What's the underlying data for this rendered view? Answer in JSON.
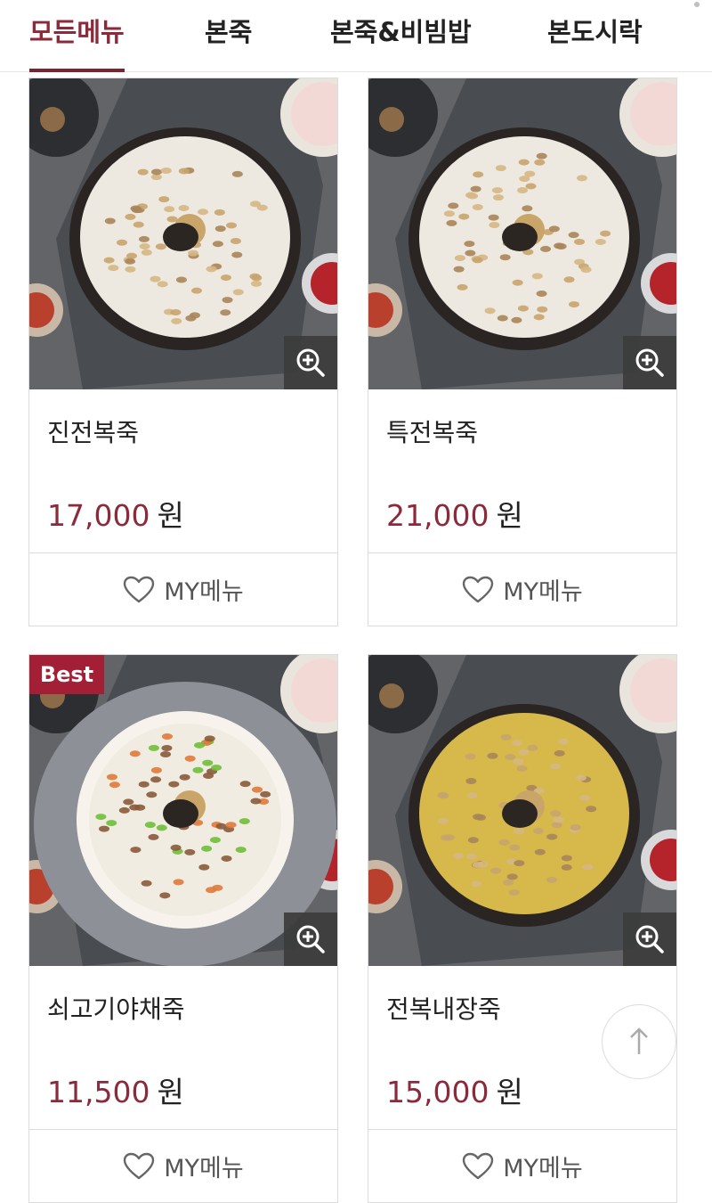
{
  "tabs": [
    {
      "label": "모든메뉴",
      "active": true
    },
    {
      "label": "본죽",
      "active": false
    },
    {
      "label": "본죽&비빔밥",
      "active": false
    },
    {
      "label": "본도시락",
      "active": false
    }
  ],
  "products": [
    {
      "name": "진전복죽",
      "price": "17,000",
      "unit": "원",
      "badge": "",
      "my_label": "MY메뉴",
      "bowl": "dark",
      "porridge": "#eee9e0"
    },
    {
      "name": "특전복죽",
      "price": "21,000",
      "unit": "원",
      "badge": "",
      "my_label": "MY메뉴",
      "bowl": "dark",
      "porridge": "#eee9e0"
    },
    {
      "name": "쇠고기야채죽",
      "price": "11,500",
      "unit": "원",
      "badge": "Best",
      "my_label": "MY메뉴",
      "bowl": "white",
      "porridge": "#f1ece2"
    },
    {
      "name": "전복내장죽",
      "price": "15,000",
      "unit": "원",
      "badge": "",
      "my_label": "MY메뉴",
      "bowl": "dark",
      "porridge": "#d7b84a"
    }
  ],
  "icons": {
    "zoom": "zoom-in-icon",
    "heart": "heart-outline-icon",
    "to_top": "arrow-up-icon"
  },
  "colors": {
    "accent": "#8a2a3b",
    "badge": "#a21f36"
  }
}
